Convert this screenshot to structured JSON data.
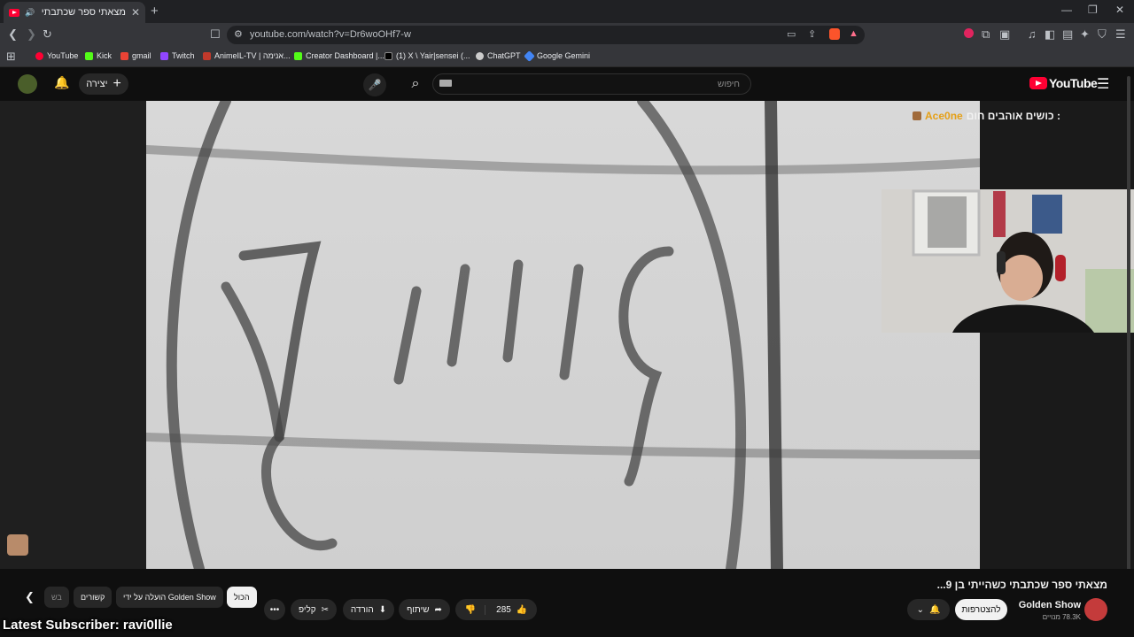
{
  "browser": {
    "tab_title": "מצאתי ספר שכתבתי כשהייתי",
    "url": "youtube.com/watch?v=Dr6woOHf7-w",
    "bookmarks": [
      {
        "label": "YouTube",
        "color": "#ff0033"
      },
      {
        "label": "Kick",
        "color": "#53fc18"
      },
      {
        "label": "gmail",
        "color": "#ea4335"
      },
      {
        "label": "Twitch",
        "color": "#9146ff"
      },
      {
        "label": "AnimeIL-TV | אנימה...",
        "color": "#c0392b"
      },
      {
        "label": "Creator Dashboard |...",
        "color": "#53fc18"
      },
      {
        "label": "(1) X \\ Yair|sensei (...",
        "color": "#ffffff"
      },
      {
        "label": "ChatGPT",
        "color": "#cccccc"
      },
      {
        "label": "Google Gemini",
        "color": "#4285f4"
      }
    ]
  },
  "header": {
    "create_label": "יצירה",
    "search_placeholder": "חיפוש",
    "logo_text": "YouTube"
  },
  "chat": {
    "user": "Ace0ne",
    "message": ": כושים אוהבים חום"
  },
  "video": {
    "title": "מצאתי ספר שכתבתי כשהייתי בן 9...",
    "channel_name": "Golden Show",
    "subscribers": "78.3K מנויים",
    "subscribe_label": "להצטרפות",
    "like_count": "285",
    "share_label": "שיתוף",
    "download_label": "הורדה",
    "clip_label": "קליפ"
  },
  "chips": {
    "all": "הכול",
    "uploaded_by": "הועלה על ידי Golden Show",
    "related": "קשורים",
    "partial": "בש"
  },
  "overlay": {
    "latest_subscriber": "Latest Subscriber: ravi0llie"
  }
}
